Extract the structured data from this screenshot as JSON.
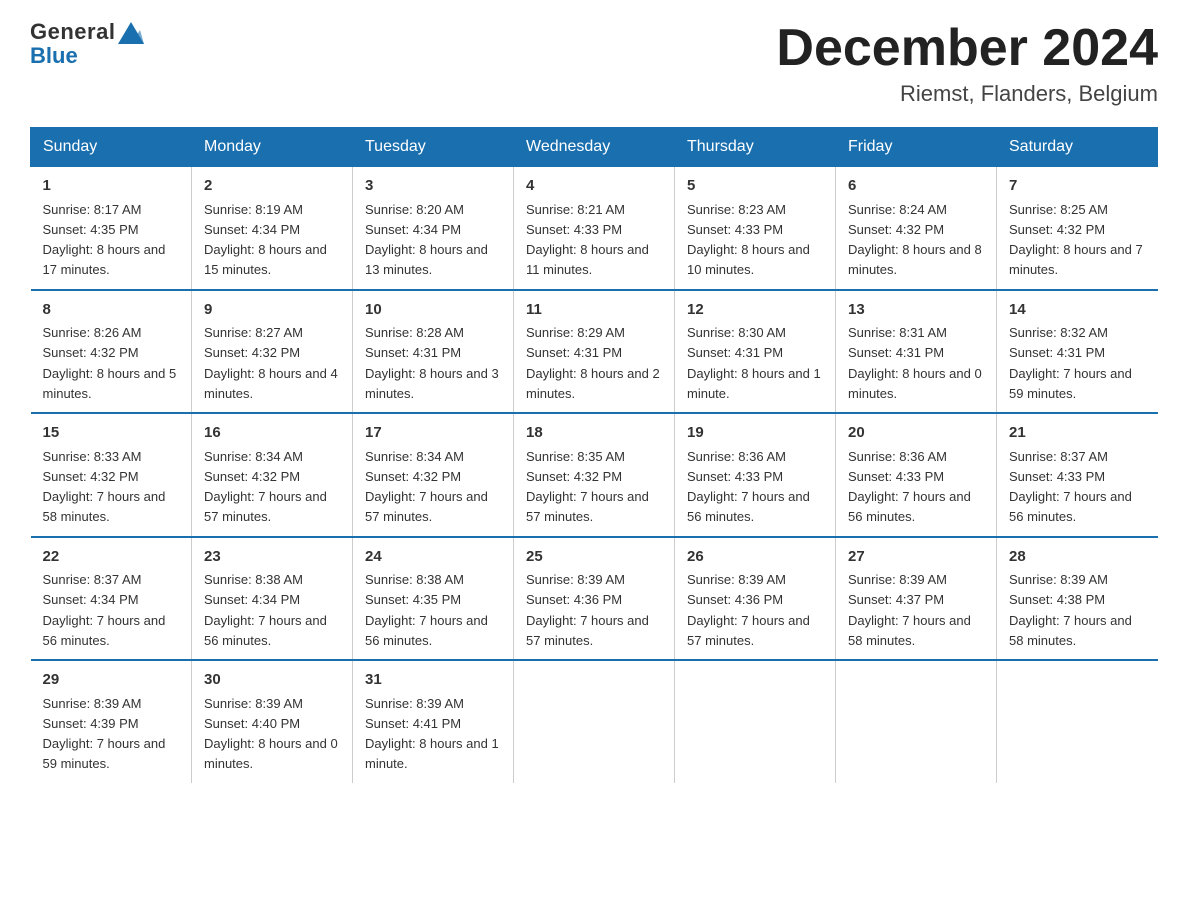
{
  "logo": {
    "text_general": "General",
    "text_blue": "Blue",
    "arrow_color": "#1a6faf"
  },
  "title": "December 2024",
  "location": "Riemst, Flanders, Belgium",
  "days_of_week": [
    "Sunday",
    "Monday",
    "Tuesday",
    "Wednesday",
    "Thursday",
    "Friday",
    "Saturday"
  ],
  "weeks": [
    [
      {
        "day": "1",
        "sunrise": "8:17 AM",
        "sunset": "4:35 PM",
        "daylight": "8 hours and 17 minutes."
      },
      {
        "day": "2",
        "sunrise": "8:19 AM",
        "sunset": "4:34 PM",
        "daylight": "8 hours and 15 minutes."
      },
      {
        "day": "3",
        "sunrise": "8:20 AM",
        "sunset": "4:34 PM",
        "daylight": "8 hours and 13 minutes."
      },
      {
        "day": "4",
        "sunrise": "8:21 AM",
        "sunset": "4:33 PM",
        "daylight": "8 hours and 11 minutes."
      },
      {
        "day": "5",
        "sunrise": "8:23 AM",
        "sunset": "4:33 PM",
        "daylight": "8 hours and 10 minutes."
      },
      {
        "day": "6",
        "sunrise": "8:24 AM",
        "sunset": "4:32 PM",
        "daylight": "8 hours and 8 minutes."
      },
      {
        "day": "7",
        "sunrise": "8:25 AM",
        "sunset": "4:32 PM",
        "daylight": "8 hours and 7 minutes."
      }
    ],
    [
      {
        "day": "8",
        "sunrise": "8:26 AM",
        "sunset": "4:32 PM",
        "daylight": "8 hours and 5 minutes."
      },
      {
        "day": "9",
        "sunrise": "8:27 AM",
        "sunset": "4:32 PM",
        "daylight": "8 hours and 4 minutes."
      },
      {
        "day": "10",
        "sunrise": "8:28 AM",
        "sunset": "4:31 PM",
        "daylight": "8 hours and 3 minutes."
      },
      {
        "day": "11",
        "sunrise": "8:29 AM",
        "sunset": "4:31 PM",
        "daylight": "8 hours and 2 minutes."
      },
      {
        "day": "12",
        "sunrise": "8:30 AM",
        "sunset": "4:31 PM",
        "daylight": "8 hours and 1 minute."
      },
      {
        "day": "13",
        "sunrise": "8:31 AM",
        "sunset": "4:31 PM",
        "daylight": "8 hours and 0 minutes."
      },
      {
        "day": "14",
        "sunrise": "8:32 AM",
        "sunset": "4:31 PM",
        "daylight": "7 hours and 59 minutes."
      }
    ],
    [
      {
        "day": "15",
        "sunrise": "8:33 AM",
        "sunset": "4:32 PM",
        "daylight": "7 hours and 58 minutes."
      },
      {
        "day": "16",
        "sunrise": "8:34 AM",
        "sunset": "4:32 PM",
        "daylight": "7 hours and 57 minutes."
      },
      {
        "day": "17",
        "sunrise": "8:34 AM",
        "sunset": "4:32 PM",
        "daylight": "7 hours and 57 minutes."
      },
      {
        "day": "18",
        "sunrise": "8:35 AM",
        "sunset": "4:32 PM",
        "daylight": "7 hours and 57 minutes."
      },
      {
        "day": "19",
        "sunrise": "8:36 AM",
        "sunset": "4:33 PM",
        "daylight": "7 hours and 56 minutes."
      },
      {
        "day": "20",
        "sunrise": "8:36 AM",
        "sunset": "4:33 PM",
        "daylight": "7 hours and 56 minutes."
      },
      {
        "day": "21",
        "sunrise": "8:37 AM",
        "sunset": "4:33 PM",
        "daylight": "7 hours and 56 minutes."
      }
    ],
    [
      {
        "day": "22",
        "sunrise": "8:37 AM",
        "sunset": "4:34 PM",
        "daylight": "7 hours and 56 minutes."
      },
      {
        "day": "23",
        "sunrise": "8:38 AM",
        "sunset": "4:34 PM",
        "daylight": "7 hours and 56 minutes."
      },
      {
        "day": "24",
        "sunrise": "8:38 AM",
        "sunset": "4:35 PM",
        "daylight": "7 hours and 56 minutes."
      },
      {
        "day": "25",
        "sunrise": "8:39 AM",
        "sunset": "4:36 PM",
        "daylight": "7 hours and 57 minutes."
      },
      {
        "day": "26",
        "sunrise": "8:39 AM",
        "sunset": "4:36 PM",
        "daylight": "7 hours and 57 minutes."
      },
      {
        "day": "27",
        "sunrise": "8:39 AM",
        "sunset": "4:37 PM",
        "daylight": "7 hours and 58 minutes."
      },
      {
        "day": "28",
        "sunrise": "8:39 AM",
        "sunset": "4:38 PM",
        "daylight": "7 hours and 58 minutes."
      }
    ],
    [
      {
        "day": "29",
        "sunrise": "8:39 AM",
        "sunset": "4:39 PM",
        "daylight": "7 hours and 59 minutes."
      },
      {
        "day": "30",
        "sunrise": "8:39 AM",
        "sunset": "4:40 PM",
        "daylight": "8 hours and 0 minutes."
      },
      {
        "day": "31",
        "sunrise": "8:39 AM",
        "sunset": "4:41 PM",
        "daylight": "8 hours and 1 minute."
      },
      null,
      null,
      null,
      null
    ]
  ]
}
